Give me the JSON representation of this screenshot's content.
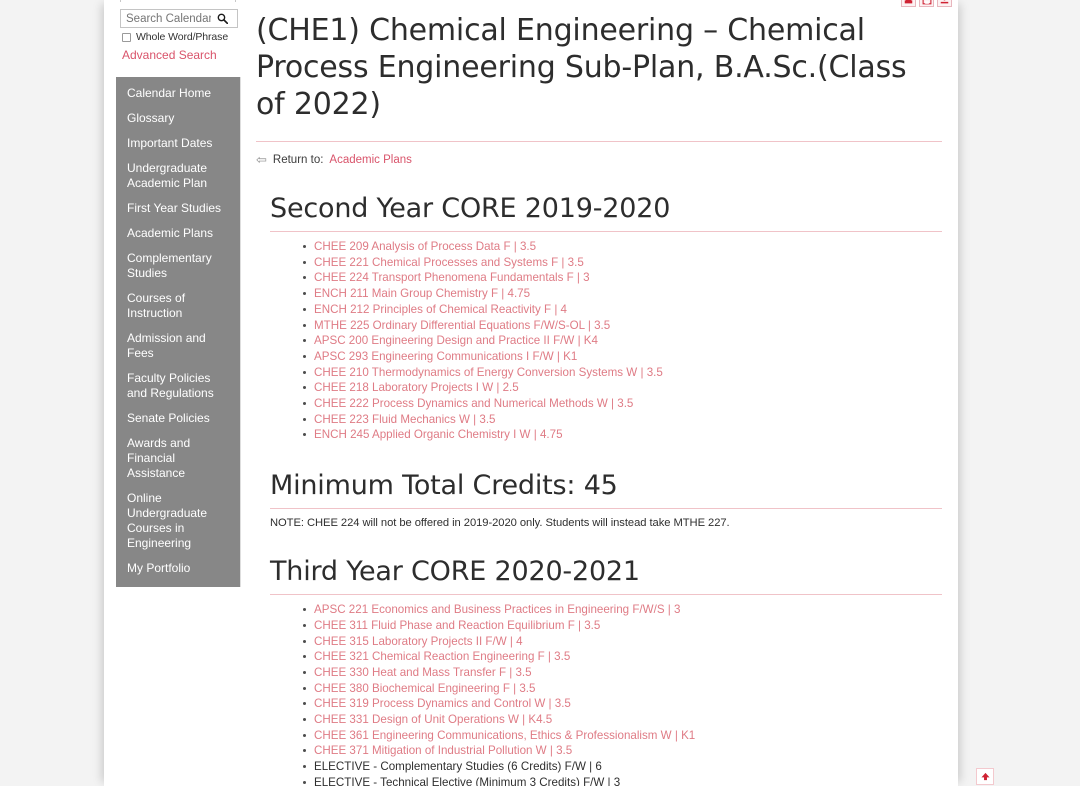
{
  "sidebar": {
    "search": {
      "placeholder": "Search Calendar",
      "value": "",
      "icon": "search-icon",
      "whole_word_label": "Whole Word/Phrase",
      "whole_word_checked": false,
      "advanced_search_label": "Advanced Search"
    },
    "items": [
      {
        "label": "Calendar Home"
      },
      {
        "label": "Glossary"
      },
      {
        "label": "Important Dates"
      },
      {
        "label": "Undergraduate Academic Plan"
      },
      {
        "label": "First Year Studies"
      },
      {
        "label": "Academic Plans"
      },
      {
        "label": "Complementary Studies"
      },
      {
        "label": "Courses of Instruction"
      },
      {
        "label": "Admission and Fees"
      },
      {
        "label": "Faculty Policies and Regulations"
      },
      {
        "label": "Senate Policies"
      },
      {
        "label": "Awards and Financial Assistance"
      },
      {
        "label": "Online Undergraduate Courses in Engineering"
      },
      {
        "label": "My Portfolio"
      }
    ]
  },
  "page_icons": [
    {
      "name": "print-icon",
      "glyph": "■"
    },
    {
      "name": "share-icon",
      "glyph": "⬒"
    },
    {
      "name": "help-info-icon",
      "glyph": "ℹ"
    }
  ],
  "main": {
    "title": "(CHE1) Chemical Engineering – Chemical Process Engineering Sub-Plan, B.A.Sc.(Class of 2022)",
    "return_prefix": "Return to:",
    "return_link": "Academic Plans",
    "sections": [
      {
        "heading": "Second Year CORE 2019-2020",
        "courses": [
          {
            "text": "CHEE 209 Analysis of Process Data F | 3.5",
            "link": true
          },
          {
            "text": "CHEE 221 Chemical Processes and Systems F | 3.5",
            "link": true
          },
          {
            "text": "CHEE 224 Transport Phenomena Fundamentals F | 3",
            "link": true
          },
          {
            "text": "ENCH 211 Main Group Chemistry F | 4.75",
            "link": true
          },
          {
            "text": "ENCH 212 Principles of Chemical Reactivity F | 4",
            "link": true
          },
          {
            "text": "MTHE 225 Ordinary Differential Equations F/W/S-OL | 3.5",
            "link": true
          },
          {
            "text": "APSC 200 Engineering Design and Practice II F/W | K4",
            "link": true
          },
          {
            "text": "APSC 293 Engineering Communications I F/W | K1",
            "link": true
          },
          {
            "text": "CHEE 210 Thermodynamics of Energy Conversion Systems W | 3.5",
            "link": true
          },
          {
            "text": "CHEE 218 Laboratory Projects I W | 2.5",
            "link": true
          },
          {
            "text": "CHEE 222 Process Dynamics and Numerical Methods W | 3.5",
            "link": true
          },
          {
            "text": "CHEE 223 Fluid Mechanics W | 3.5",
            "link": true
          },
          {
            "text": "ENCH 245 Applied Organic Chemistry I W | 4.75",
            "link": true
          }
        ]
      },
      {
        "heading": "Minimum Total Credits: 45",
        "note": "NOTE:  CHEE 224 will not be offered in 2019-2020 only.  Students will instead take MTHE 227.",
        "courses": []
      },
      {
        "heading": "Third Year CORE 2020-2021",
        "courses": [
          {
            "text": "APSC 221 Economics and Business Practices in Engineering F/W/S | 3",
            "link": true
          },
          {
            "text": "CHEE 311 Fluid Phase and Reaction Equilibrium F | 3.5",
            "link": true
          },
          {
            "text": "CHEE 315 Laboratory Projects II F/W | 4",
            "link": true
          },
          {
            "text": "CHEE 321 Chemical Reaction Engineering F | 3.5",
            "link": true
          },
          {
            "text": "CHEE 330 Heat and Mass Transfer F | 3.5",
            "link": true
          },
          {
            "text": "CHEE 380 Biochemical Engineering F | 3.5",
            "link": true
          },
          {
            "text": "CHEE 319 Process Dynamics and Control W | 3.5",
            "link": true
          },
          {
            "text": "CHEE 331 Design of Unit Operations W | K4.5",
            "link": true
          },
          {
            "text": "CHEE 361 Engineering Communications, Ethics & Professionalism W | K1",
            "link": true
          },
          {
            "text": "CHEE 371 Mitigation of Industrial Pollution W | 3.5",
            "link": true
          },
          {
            "text": "ELECTIVE - Complementary Studies (6 Credits) F/W | 6",
            "link": false
          },
          {
            "text": "ELECTIVE - Technical Elective (Minimum 3 Credits) F/W | 3",
            "link": false
          }
        ]
      }
    ]
  },
  "back_to_top": {
    "name": "back-to-top-icon",
    "glyph": "⬆"
  },
  "colors": {
    "link": "#df7b85",
    "accent": "#d9546b",
    "sidebar_bg": "#878787",
    "rule": "#f0c3c8"
  }
}
